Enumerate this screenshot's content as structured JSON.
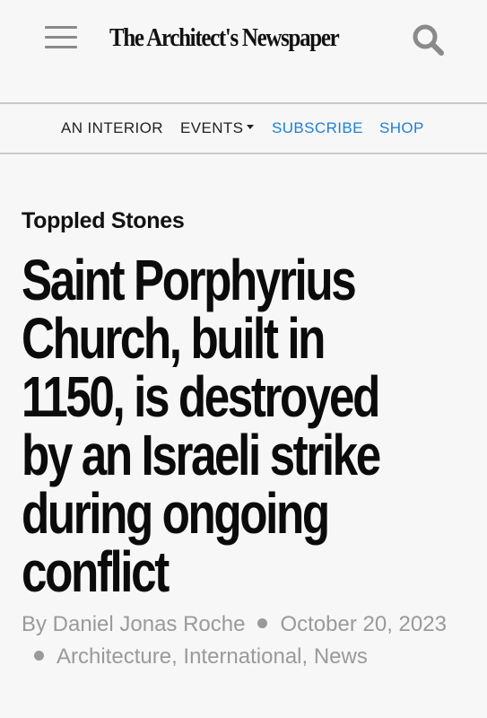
{
  "header": {
    "logo_text": "The Architect's Newspaper",
    "menu_icon": "hamburger-menu-icon",
    "search_icon": "search-icon"
  },
  "nav": {
    "items": [
      {
        "label": "AN INTERIOR"
      },
      {
        "label": "EVENTS",
        "has_dropdown": true
      },
      {
        "label": "SUBSCRIBE"
      },
      {
        "label": "SHOP"
      }
    ],
    "link_color": "#1d7fd6"
  },
  "article": {
    "kicker": "Toppled Stones",
    "headline": "Saint Porphyrius Church, built in 1150, is destroyed by an Israeli strike during ongoing conflict",
    "author_line": "By Daniel Jonas Roche",
    "date": "October 20, 2023",
    "categories": [
      {
        "label": "Architecture"
      },
      {
        "label": "International"
      },
      {
        "label": "News"
      }
    ],
    "category_separator": ","
  }
}
